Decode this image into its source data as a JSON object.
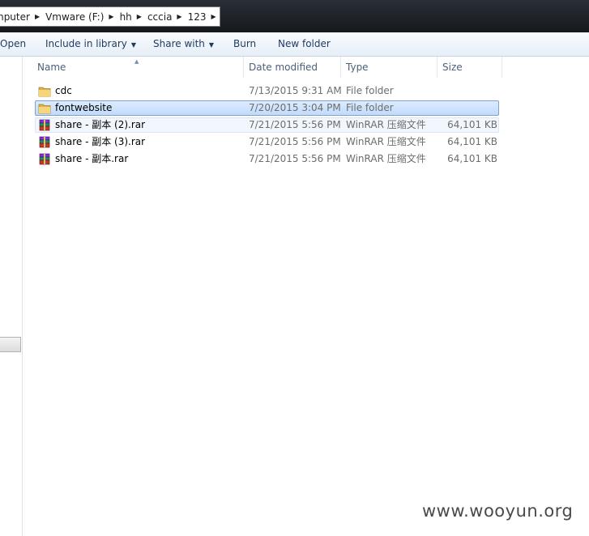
{
  "breadcrumb": [
    {
      "label": "mputer"
    },
    {
      "label": "Vmware (F:)"
    },
    {
      "label": "hh"
    },
    {
      "label": "cccia"
    },
    {
      "label": "123"
    }
  ],
  "toolbar": {
    "open": "Open",
    "include_in_library": "Include in library",
    "share_with": "Share with",
    "burn": "Burn",
    "new_folder": "New folder"
  },
  "columns": {
    "name": "Name",
    "date_modified": "Date modified",
    "type": "Type",
    "size": "Size"
  },
  "files": [
    {
      "name": "cdc",
      "date": "7/13/2015 9:31 AM",
      "type": "File folder",
      "size": "",
      "icon": "folder-icon"
    },
    {
      "name": "fontwebsite",
      "date": "7/20/2015 3:04 PM",
      "type": "File folder",
      "size": "",
      "icon": "folder-icon"
    },
    {
      "name": "share - 副本 (2).rar",
      "date": "7/21/2015 5:56 PM",
      "type": "WinRAR 压缩文件",
      "size": "64,101 KB",
      "icon": "winrar-archive-icon"
    },
    {
      "name": "share - 副本 (3).rar",
      "date": "7/21/2015 5:56 PM",
      "type": "WinRAR 压缩文件",
      "size": "64,101 KB",
      "icon": "winrar-archive-icon"
    },
    {
      "name": "share - 副本.rar",
      "date": "7/21/2015 5:56 PM",
      "type": "WinRAR 压缩文件",
      "size": "64,101 KB",
      "icon": "winrar-archive-icon"
    }
  ],
  "selected_file": "fontwebsite",
  "watermark": "www.wooyun.org",
  "colors": {
    "selection": "#cce0fb",
    "toolbar_text": "#1e3a5f",
    "header_text": "#4c607a",
    "folder": "#e8c25a"
  }
}
